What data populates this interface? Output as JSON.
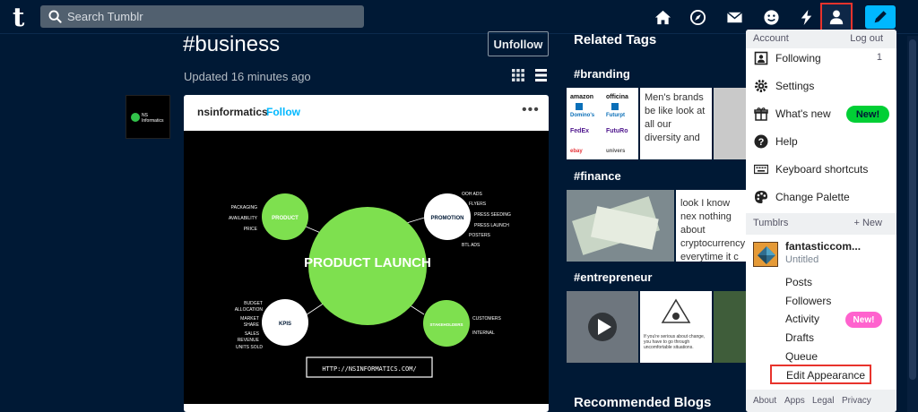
{
  "topbar": {
    "logo": "t",
    "search_placeholder": "Search Tumblr",
    "icons": [
      "home-icon",
      "explore-icon",
      "inbox-icon",
      "chat-icon",
      "activity-icon",
      "account-icon",
      "compose-icon"
    ]
  },
  "tag": {
    "title": "#business",
    "unfollow_label": "Unfollow",
    "updated": "Updated 16 minutes ago"
  },
  "post": {
    "author": "nsinformatics",
    "follow_label": "Follow",
    "more": "•••",
    "image": {
      "center": "PRODUCT LAUNCH",
      "nodes": [
        "PRODUCT",
        "PROMOTION",
        "KPIS",
        "STAKEHOLDERS"
      ],
      "product_items": [
        "PACKAGING",
        "AVAILABILITY",
        "PRICE"
      ],
      "promotion_items": [
        "OOH ADS",
        "FLYERS",
        "PRESS SEEDING",
        "PRESS LAUNCH",
        "POSTERS",
        "BTL ADS"
      ],
      "kpi_items": [
        "BUDGET",
        "ALLOCATION",
        "MARKET",
        "SHARE",
        "SALES",
        "REVENUE",
        "UNITS SOLD"
      ],
      "stakeholder_items": [
        "CUSTOMERS",
        "INTERNAL"
      ],
      "url": "HTTP://NSINFORMATICS.COM/"
    },
    "blog_avatar_text": [
      "NS",
      "Informatics"
    ]
  },
  "related": {
    "title": "Related Tags",
    "tags": [
      {
        "label": "#branding",
        "text": "Men's brands be like look at all our diversity and",
        "logos": [
          "amazon",
          "officina",
          "Domino's",
          "Futurpt",
          "FedEx",
          "FutuRo",
          "ebay",
          "univers"
        ]
      },
      {
        "label": "#finance",
        "text": "look I know nex nothing about cryptocurrency everytime it c"
      },
      {
        "label": "#entrepreneur",
        "text": "If you're serious about change, you have to go through uncomfortable situations."
      }
    ],
    "recommended": "Recommended Blogs"
  },
  "account_menu": {
    "header_left": "Account",
    "header_right": "Log out",
    "items": [
      {
        "label": "Following",
        "count": "1",
        "icon": "following-icon"
      },
      {
        "label": "Settings",
        "icon": "settings-icon"
      },
      {
        "label": "What's new",
        "badge": "New!",
        "icon": "gift-icon"
      },
      {
        "label": "Help",
        "icon": "help-icon"
      },
      {
        "label": "Keyboard shortcuts",
        "icon": "keyboard-icon"
      },
      {
        "label": "Change Palette",
        "icon": "palette-icon"
      }
    ],
    "tumblrs_label": "Tumblrs",
    "new_label": "+ New",
    "blog": {
      "name": "fantasticcom...",
      "subtitle": "Untitled"
    },
    "blog_items": [
      "Posts",
      "Followers",
      "Activity",
      "Drafts",
      "Queue",
      "Edit Appearance"
    ],
    "activity_badge": "New!",
    "footer": [
      "About",
      "Apps",
      "Legal",
      "Privacy"
    ]
  },
  "colors": {
    "background": "#001935",
    "accent": "#00b8ff",
    "green": "#01cf35",
    "pink": "#ff62ce",
    "highlight": "#e8332c"
  }
}
